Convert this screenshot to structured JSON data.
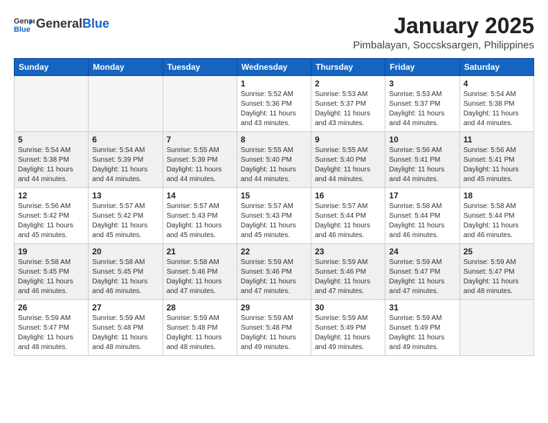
{
  "header": {
    "logo_general": "General",
    "logo_blue": "Blue",
    "month_title": "January 2025",
    "location": "Pimbalayan, Soccsksargen, Philippines"
  },
  "days_of_week": [
    "Sunday",
    "Monday",
    "Tuesday",
    "Wednesday",
    "Thursday",
    "Friday",
    "Saturday"
  ],
  "weeks": [
    [
      {
        "day": "",
        "sunrise": "",
        "sunset": "",
        "daylight": "",
        "empty": true
      },
      {
        "day": "",
        "sunrise": "",
        "sunset": "",
        "daylight": "",
        "empty": true
      },
      {
        "day": "",
        "sunrise": "",
        "sunset": "",
        "daylight": "",
        "empty": true
      },
      {
        "day": "1",
        "sunrise": "Sunrise: 5:52 AM",
        "sunset": "Sunset: 5:36 PM",
        "daylight": "Daylight: 11 hours and 43 minutes.",
        "empty": false
      },
      {
        "day": "2",
        "sunrise": "Sunrise: 5:53 AM",
        "sunset": "Sunset: 5:37 PM",
        "daylight": "Daylight: 11 hours and 43 minutes.",
        "empty": false
      },
      {
        "day": "3",
        "sunrise": "Sunrise: 5:53 AM",
        "sunset": "Sunset: 5:37 PM",
        "daylight": "Daylight: 11 hours and 44 minutes.",
        "empty": false
      },
      {
        "day": "4",
        "sunrise": "Sunrise: 5:54 AM",
        "sunset": "Sunset: 5:38 PM",
        "daylight": "Daylight: 11 hours and 44 minutes.",
        "empty": false
      }
    ],
    [
      {
        "day": "5",
        "sunrise": "Sunrise: 5:54 AM",
        "sunset": "Sunset: 5:38 PM",
        "daylight": "Daylight: 11 hours and 44 minutes.",
        "empty": false
      },
      {
        "day": "6",
        "sunrise": "Sunrise: 5:54 AM",
        "sunset": "Sunset: 5:39 PM",
        "daylight": "Daylight: 11 hours and 44 minutes.",
        "empty": false
      },
      {
        "day": "7",
        "sunrise": "Sunrise: 5:55 AM",
        "sunset": "Sunset: 5:39 PM",
        "daylight": "Daylight: 11 hours and 44 minutes.",
        "empty": false
      },
      {
        "day": "8",
        "sunrise": "Sunrise: 5:55 AM",
        "sunset": "Sunset: 5:40 PM",
        "daylight": "Daylight: 11 hours and 44 minutes.",
        "empty": false
      },
      {
        "day": "9",
        "sunrise": "Sunrise: 5:55 AM",
        "sunset": "Sunset: 5:40 PM",
        "daylight": "Daylight: 11 hours and 44 minutes.",
        "empty": false
      },
      {
        "day": "10",
        "sunrise": "Sunrise: 5:56 AM",
        "sunset": "Sunset: 5:41 PM",
        "daylight": "Daylight: 11 hours and 44 minutes.",
        "empty": false
      },
      {
        "day": "11",
        "sunrise": "Sunrise: 5:56 AM",
        "sunset": "Sunset: 5:41 PM",
        "daylight": "Daylight: 11 hours and 45 minutes.",
        "empty": false
      }
    ],
    [
      {
        "day": "12",
        "sunrise": "Sunrise: 5:56 AM",
        "sunset": "Sunset: 5:42 PM",
        "daylight": "Daylight: 11 hours and 45 minutes.",
        "empty": false
      },
      {
        "day": "13",
        "sunrise": "Sunrise: 5:57 AM",
        "sunset": "Sunset: 5:42 PM",
        "daylight": "Daylight: 11 hours and 45 minutes.",
        "empty": false
      },
      {
        "day": "14",
        "sunrise": "Sunrise: 5:57 AM",
        "sunset": "Sunset: 5:43 PM",
        "daylight": "Daylight: 11 hours and 45 minutes.",
        "empty": false
      },
      {
        "day": "15",
        "sunrise": "Sunrise: 5:57 AM",
        "sunset": "Sunset: 5:43 PM",
        "daylight": "Daylight: 11 hours and 45 minutes.",
        "empty": false
      },
      {
        "day": "16",
        "sunrise": "Sunrise: 5:57 AM",
        "sunset": "Sunset: 5:44 PM",
        "daylight": "Daylight: 11 hours and 46 minutes.",
        "empty": false
      },
      {
        "day": "17",
        "sunrise": "Sunrise: 5:58 AM",
        "sunset": "Sunset: 5:44 PM",
        "daylight": "Daylight: 11 hours and 46 minutes.",
        "empty": false
      },
      {
        "day": "18",
        "sunrise": "Sunrise: 5:58 AM",
        "sunset": "Sunset: 5:44 PM",
        "daylight": "Daylight: 11 hours and 46 minutes.",
        "empty": false
      }
    ],
    [
      {
        "day": "19",
        "sunrise": "Sunrise: 5:58 AM",
        "sunset": "Sunset: 5:45 PM",
        "daylight": "Daylight: 11 hours and 46 minutes.",
        "empty": false
      },
      {
        "day": "20",
        "sunrise": "Sunrise: 5:58 AM",
        "sunset": "Sunset: 5:45 PM",
        "daylight": "Daylight: 11 hours and 46 minutes.",
        "empty": false
      },
      {
        "day": "21",
        "sunrise": "Sunrise: 5:58 AM",
        "sunset": "Sunset: 5:46 PM",
        "daylight": "Daylight: 11 hours and 47 minutes.",
        "empty": false
      },
      {
        "day": "22",
        "sunrise": "Sunrise: 5:59 AM",
        "sunset": "Sunset: 5:46 PM",
        "daylight": "Daylight: 11 hours and 47 minutes.",
        "empty": false
      },
      {
        "day": "23",
        "sunrise": "Sunrise: 5:59 AM",
        "sunset": "Sunset: 5:46 PM",
        "daylight": "Daylight: 11 hours and 47 minutes.",
        "empty": false
      },
      {
        "day": "24",
        "sunrise": "Sunrise: 5:59 AM",
        "sunset": "Sunset: 5:47 PM",
        "daylight": "Daylight: 11 hours and 47 minutes.",
        "empty": false
      },
      {
        "day": "25",
        "sunrise": "Sunrise: 5:59 AM",
        "sunset": "Sunset: 5:47 PM",
        "daylight": "Daylight: 11 hours and 48 minutes.",
        "empty": false
      }
    ],
    [
      {
        "day": "26",
        "sunrise": "Sunrise: 5:59 AM",
        "sunset": "Sunset: 5:47 PM",
        "daylight": "Daylight: 11 hours and 48 minutes.",
        "empty": false
      },
      {
        "day": "27",
        "sunrise": "Sunrise: 5:59 AM",
        "sunset": "Sunset: 5:48 PM",
        "daylight": "Daylight: 11 hours and 48 minutes.",
        "empty": false
      },
      {
        "day": "28",
        "sunrise": "Sunrise: 5:59 AM",
        "sunset": "Sunset: 5:48 PM",
        "daylight": "Daylight: 11 hours and 48 minutes.",
        "empty": false
      },
      {
        "day": "29",
        "sunrise": "Sunrise: 5:59 AM",
        "sunset": "Sunset: 5:48 PM",
        "daylight": "Daylight: 11 hours and 49 minutes.",
        "empty": false
      },
      {
        "day": "30",
        "sunrise": "Sunrise: 5:59 AM",
        "sunset": "Sunset: 5:49 PM",
        "daylight": "Daylight: 11 hours and 49 minutes.",
        "empty": false
      },
      {
        "day": "31",
        "sunrise": "Sunrise: 5:59 AM",
        "sunset": "Sunset: 5:49 PM",
        "daylight": "Daylight: 11 hours and 49 minutes.",
        "empty": false
      },
      {
        "day": "",
        "sunrise": "",
        "sunset": "",
        "daylight": "",
        "empty": true
      }
    ]
  ]
}
